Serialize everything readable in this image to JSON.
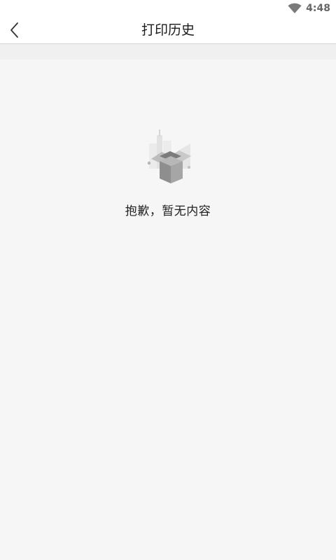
{
  "status_bar": {
    "time": "4:48",
    "icons": [
      "wifi-icon"
    ]
  },
  "app_bar": {
    "back_icon": "chevron-left-icon",
    "title": "打印历史"
  },
  "empty_state": {
    "illustration": "empty-box-icon",
    "message": "抱歉，暂无内容"
  },
  "colors": {
    "background": "#f6f6f6",
    "app_bar": "#ffffff",
    "title_text": "#1a1a1a",
    "illustration": "#9e9e9e"
  }
}
